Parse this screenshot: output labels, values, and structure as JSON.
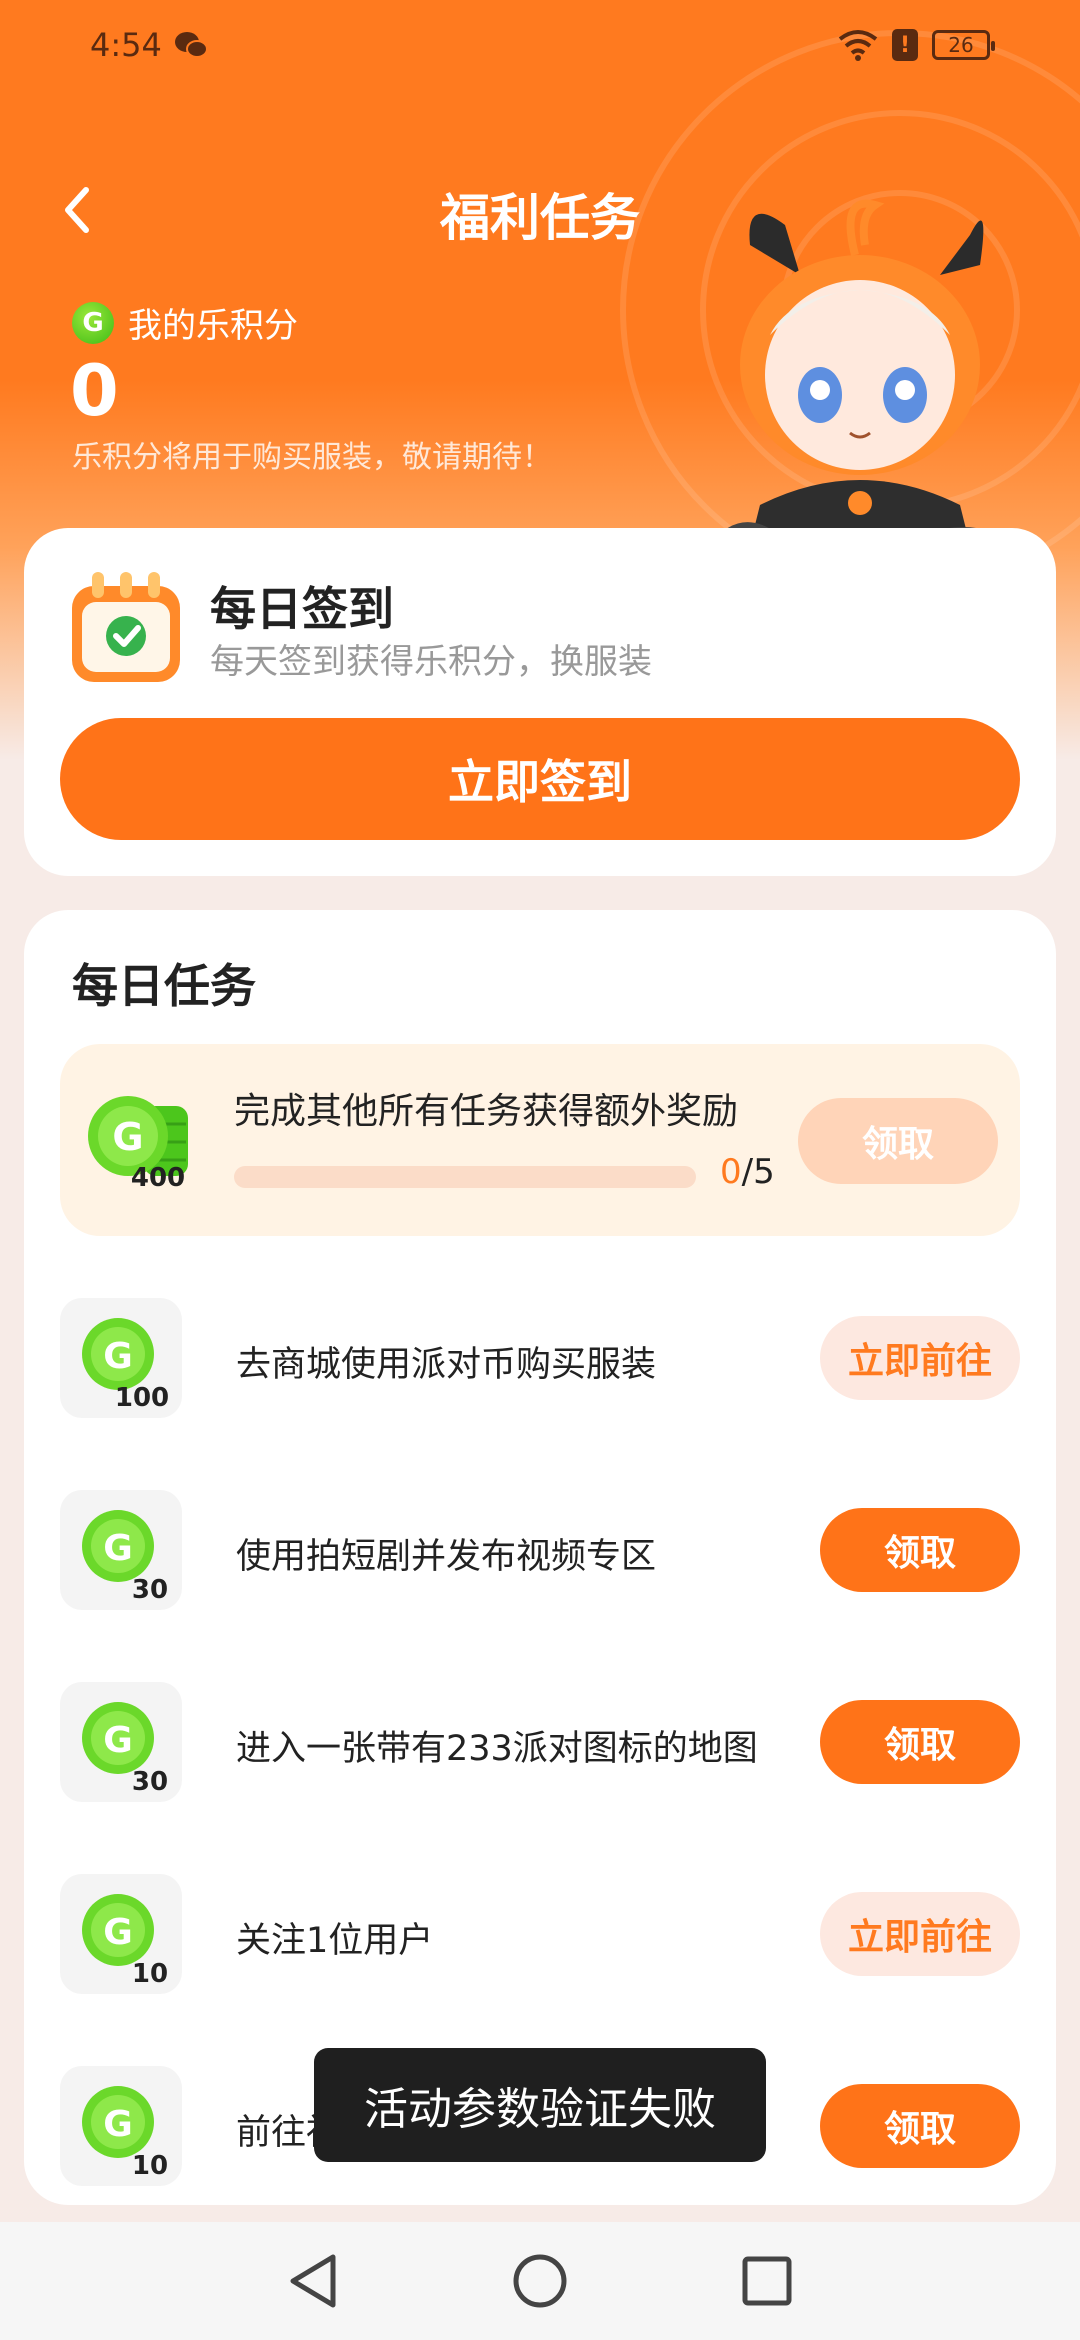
{
  "status_bar": {
    "time": "4:54",
    "battery": "26",
    "alert": "!"
  },
  "header": {
    "title": "福利任务"
  },
  "points": {
    "label": "我的乐积分",
    "value": "0",
    "note": "乐积分将用于购买服装，敬请期待！"
  },
  "sign_in": {
    "title": "每日签到",
    "subtitle": "每天签到获得乐积分，换服装",
    "button": "立即签到"
  },
  "tasks": {
    "heading": "每日任务",
    "bonus": {
      "text": "完成其他所有任务获得额外奖励",
      "reward": "400",
      "progress_current": "0",
      "progress_total": "/5",
      "progress_fraction": 0,
      "button": "领取"
    },
    "items": [
      {
        "label": "去商城使用派对币购买服装",
        "reward": "100",
        "button": "立即前往"
      },
      {
        "label": "使用拍短剧并发布视频专区",
        "reward": "30",
        "button": "领取"
      },
      {
        "label": "进入一张带有233派对图标的地图",
        "reward": "30",
        "button": "领取"
      },
      {
        "label": "关注1位用户",
        "reward": "10",
        "button": "立即前往"
      },
      {
        "label": "前往社",
        "reward": "10",
        "button": "领取"
      }
    ]
  },
  "toast": {
    "message": "活动参数验证失败"
  },
  "colors": {
    "accent": "#ff7318",
    "coin_green": "#4cc61c",
    "bonus_bg": "#fff3e4"
  }
}
